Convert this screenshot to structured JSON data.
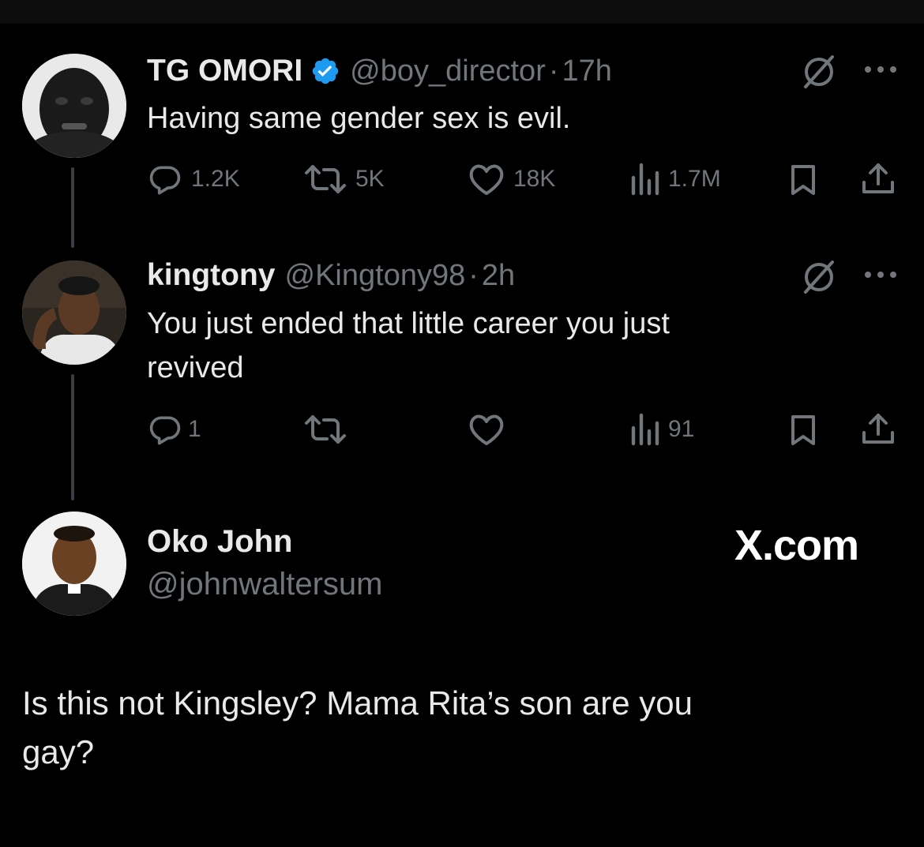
{
  "tweets": [
    {
      "name": "TG OMORI",
      "handle": "@boy_director",
      "separator": "·",
      "time": "17h",
      "text": "Having same gender sex is evil.",
      "replies": "1.2K",
      "reposts": "5K",
      "likes": "18K",
      "views": "1.7M",
      "verified": true
    },
    {
      "name": "kingtony",
      "handle": "@Kingtony98",
      "separator": "·",
      "time": "2h",
      "text_lines": [
        "You just ended that little career you just",
        "revived"
      ],
      "replies": "1",
      "reposts": "",
      "likes": "",
      "views": "91"
    }
  ],
  "reply_card": {
    "name": "Oko John",
    "handle": "@johnwaltersum",
    "brand": "X.com",
    "text_lines": [
      "Is this not Kingsley? Mama Rita’s son are you",
      "gay?"
    ]
  },
  "icons": {
    "verified": "verified-badge-icon",
    "grok": "grok-icon",
    "more": "more-icon",
    "reply": "reply-icon",
    "repost": "repost-icon",
    "like": "like-icon",
    "views": "views-icon",
    "bookmark": "bookmark-icon",
    "share": "share-icon"
  },
  "colors": {
    "background": "#000000",
    "text": "#e7e9ea",
    "muted": "#71767b",
    "verified": "#1d9bf0",
    "thread_line": "#3a3d41"
  }
}
